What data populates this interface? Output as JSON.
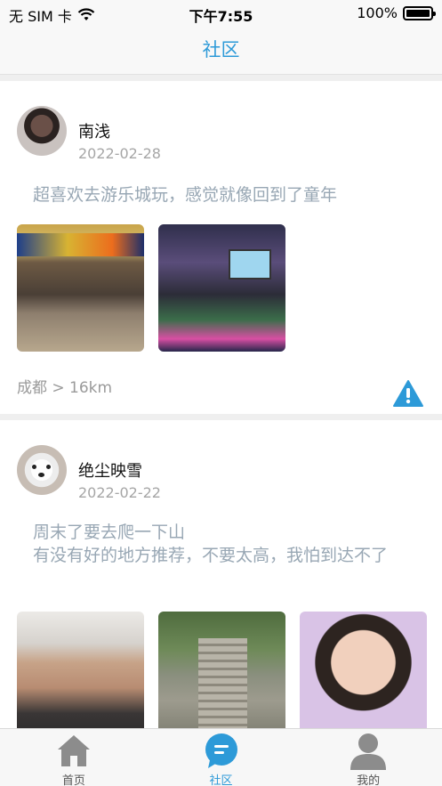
{
  "status_bar": {
    "carrier": "无 SIM 卡",
    "time": "下午7:55",
    "battery": "100%",
    "battery_level": 1.0
  },
  "nav": {
    "title": "社区"
  },
  "posts": [
    {
      "username": "南浅",
      "date": "2022-02-28",
      "content": "超喜欢去游乐城玩，感觉就像回到了童年",
      "location": "成都 > 16km"
    },
    {
      "username": "绝尘映雪",
      "date": "2022-02-22",
      "content": "周末了要去爬一下山\n有没有好的地方推荐，不要太高，我怕到达不了"
    }
  ],
  "tabs": [
    {
      "label": "首页",
      "icon": "home-icon",
      "active": false
    },
    {
      "label": "社区",
      "icon": "chat-icon",
      "active": true
    },
    {
      "label": "我的",
      "icon": "user-icon",
      "active": false
    }
  ],
  "colors": {
    "accent": "#2d9ad8",
    "content_text": "#98a7b4",
    "secondary_text": "#a6a6a6",
    "tab_icon_inactive": "#8c8c8c"
  }
}
